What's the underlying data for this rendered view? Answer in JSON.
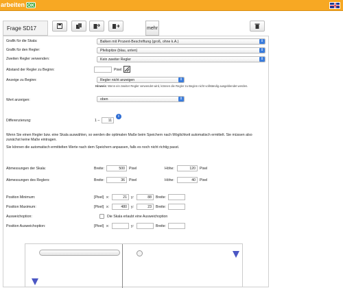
{
  "header": {
    "title": "arbeiten",
    "ok_badge": "OK",
    "language_flag": "uk-flag-icon"
  },
  "toolbar": {
    "question_label": "Frage SD17",
    "buttons": [
      "save-icon",
      "copy-icon",
      "copy-to-icon",
      "move-icon"
    ],
    "more_label": "mehr",
    "delete_icon": "trash-icon"
  },
  "form": {
    "grafik_skala_label": "Grafik für die Skala:",
    "grafik_skala_value": "Balken mit Prozent-Beschriftung (groß, ohne k.A.)",
    "grafik_regler_label": "Grafik für den Regler:",
    "grafik_regler_value": "Pfeilspitze (blau, unten)",
    "zweiten_regler_label": "Zweiten Regler verwenden:",
    "zweiten_regler_value": "Kein zweiter Regler",
    "abstand_label": "Abstand der Regler zu Beginn:",
    "abstand_unit": "Pixel",
    "anzeige_label": "Anzeige zu Beginn:",
    "anzeige_value": "Regler nicht anzeigen",
    "hint_bold": "Hinweis",
    "hint_text": ": Wenn ein zweiter Regler verwendet wird, können die Regler zu Beginn nicht vollständig ausgeblendet werden.",
    "wert_label": "Wert anzeigen:",
    "wert_value": "oben",
    "diff_label": "Differenzierung:",
    "diff_from": "1 –",
    "diff_to": "11",
    "para1": "Wenn Sie einen Regler bzw. eine Skala auswählen, so werden die optimalen Maße beim Speichern nach Möglichkeit automatisch ermittelt. Sie müssen also zunächst keine Maße eintragen.",
    "para2": "Sie können die automatisch ermittelten Werte nach dem Speichern anpassen, falls es noch nicht richtig passt.",
    "abm_skala_label": "Abmessungen der Skala:",
    "abm_regler_label": "Abmessungen des Reglers:",
    "breite_label": "Breite:",
    "hoehe_label": "Höhe:",
    "pixel_label": "Pixel",
    "skala_breite": "500",
    "skala_hoehe": "120",
    "regler_breite": "36",
    "regler_hoehe": "40",
    "pos_min_label": "Position Minimum:",
    "pos_max_label": "Position Maximum:",
    "ausweich_label": "Ausweichoption:",
    "pos_ausweich_label": "Position Ausweichoption:",
    "pixel_bracket": "[Pixel]",
    "x_label": "x:",
    "y_label": "y:",
    "min_x": "21",
    "min_y": "88",
    "max_x": "480",
    "max_y": "23",
    "ausweich_checkbox_label": "Die Skala erlaubt eine Ausweichoption"
  },
  "colors": {
    "header": "#f7a823",
    "accent": "#3b7ddd",
    "slider": "#4b57c4"
  }
}
